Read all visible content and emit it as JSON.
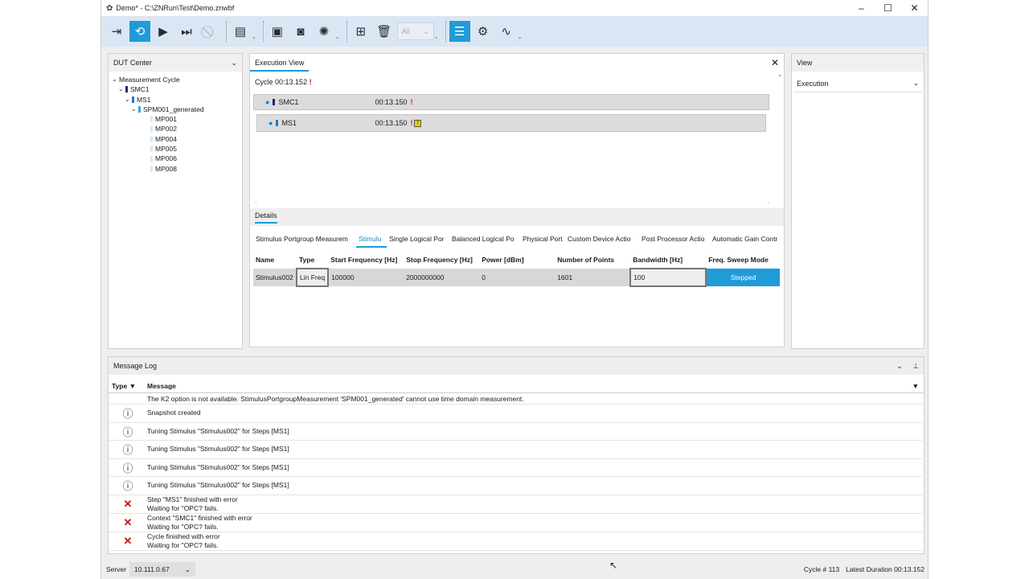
{
  "window": {
    "title": "Demo* - C:\\ZNRun\\Test\\Demo.znwbf",
    "minimize": "–",
    "maximize": "☐",
    "close": "✕"
  },
  "toolbar": {
    "icons": [
      "exit-icon",
      "loop-icon",
      "play-icon",
      "step-icon",
      "stop-icon",
      "report-icon",
      "save-icon",
      "camera-icon",
      "spinner-icon",
      "add-icon",
      "delete-icon",
      "sliders-icon",
      "gear-icon",
      "waveform-icon"
    ],
    "filter_value": "All",
    "accent": "#1f9bd8"
  },
  "dut_center": {
    "title": "DUT Center",
    "tree": [
      {
        "label": "Measurement Cycle",
        "level": 0,
        "color": ""
      },
      {
        "label": "SMC1",
        "level": 1,
        "color": "#1a2a6c"
      },
      {
        "label": "MS1",
        "level": 2,
        "color": "#1a7fc4"
      },
      {
        "label": "SPM001_generated",
        "level": 3,
        "color": "#2fa6e8"
      },
      {
        "label": "MP001",
        "level": 4,
        "color": "#d8e8f5"
      },
      {
        "label": "MP002",
        "level": 4,
        "color": "#d8e8f5"
      },
      {
        "label": "MP004",
        "level": 4,
        "color": "#d8e8f5"
      },
      {
        "label": "MP005",
        "level": 4,
        "color": "#d8e8f5"
      },
      {
        "label": "MP006",
        "level": 4,
        "color": "#d8e8f5"
      },
      {
        "label": "MP008",
        "level": 4,
        "color": "#d8e8f5"
      }
    ]
  },
  "execution": {
    "tab_label": "Execution View",
    "cycle_label": "Cycle",
    "cycle_time": "00:13.152",
    "rows": [
      {
        "name": "SMC1",
        "time": "00:13.150"
      },
      {
        "name": "MS1",
        "time": "00:13.150"
      }
    ],
    "details_label": "Details",
    "subtabs": [
      "Stimulus Portgroup Measurem",
      "Stimulu",
      "Single Logical Por",
      "Balanced Logical Po",
      "Physical Port",
      "Custom Device Actio",
      "Post Processor Actio",
      "Automatic Gain Contr"
    ],
    "columns": [
      "Name",
      "Type",
      "Start Frequency [Hz]",
      "Stop Frequency [Hz]",
      "Power [dBm]",
      "Number of Points",
      "Bandwidth [Hz]",
      "Freq. Sweep Mode"
    ],
    "row": [
      "Stimulus002",
      "Lin Freq",
      "100000",
      "2000000000",
      "0",
      "1601",
      "100",
      "Stepped"
    ]
  },
  "view": {
    "title": "View",
    "selected": "Execution"
  },
  "message_log": {
    "title": "Message Log",
    "col_type": "Type",
    "col_message": "Message",
    "truncated": "The K2 option is not available. StimulusPortgroupMeasurement 'SPM001_generated' cannot use time domain measurement.",
    "rows": [
      {
        "type": "info",
        "lines": [
          "Snapshot created"
        ]
      },
      {
        "type": "info",
        "lines": [
          "Tuning Stimulus \"Stimulus002\" for Steps [MS1]"
        ]
      },
      {
        "type": "info",
        "lines": [
          "Tuning Stimulus \"Stimulus002\" for Steps [MS1]"
        ]
      },
      {
        "type": "info",
        "lines": [
          "Tuning Stimulus \"Stimulus002\" for Steps [MS1]"
        ]
      },
      {
        "type": "info",
        "lines": [
          "Tuning Stimulus \"Stimulus002\" for Steps [MS1]"
        ]
      },
      {
        "type": "error",
        "lines": [
          "Step \"MS1\" finished with error",
          "Waiting for \"OPC? fails."
        ]
      },
      {
        "type": "error",
        "lines": [
          "Context \"SMC1\" finished with error",
          "Waiting for \"OPC? fails."
        ]
      },
      {
        "type": "error",
        "lines": [
          "Cycle finished with error",
          "Waiting for \"OPC? fails."
        ]
      }
    ]
  },
  "status": {
    "server_label": "Server",
    "server_value": "10.111.0.67",
    "cycle_label": "Cycle #",
    "cycle_value": "113",
    "duration_label": "Latest Duration",
    "duration_value": "00:13.152"
  }
}
